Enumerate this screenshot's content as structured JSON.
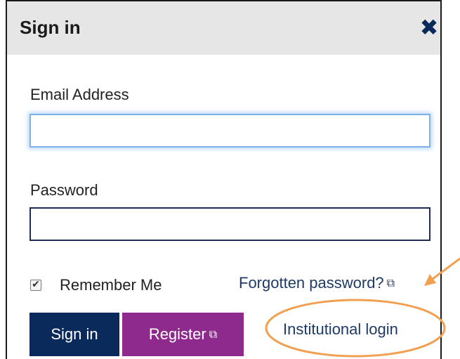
{
  "dialog": {
    "title": "Sign in",
    "close_icon": "✖"
  },
  "form": {
    "email_label": "Email Address",
    "email_value": "",
    "password_label": "Password",
    "password_value": "",
    "remember_label": "Remember Me",
    "remember_checked": true,
    "forgot_label": "Forgotten password?",
    "external_icon": "⧉"
  },
  "buttons": {
    "signin_label": "Sign in",
    "register_label": "Register",
    "register_icon": "⧉"
  },
  "links": {
    "institutional_label": "Institutional login"
  },
  "colors": {
    "header_bg": "#e6e6e6",
    "signin_bg": "#0b2a5c",
    "register_bg": "#8e2a8d",
    "link": "#1f3a66",
    "annotation": "#f0a050"
  }
}
